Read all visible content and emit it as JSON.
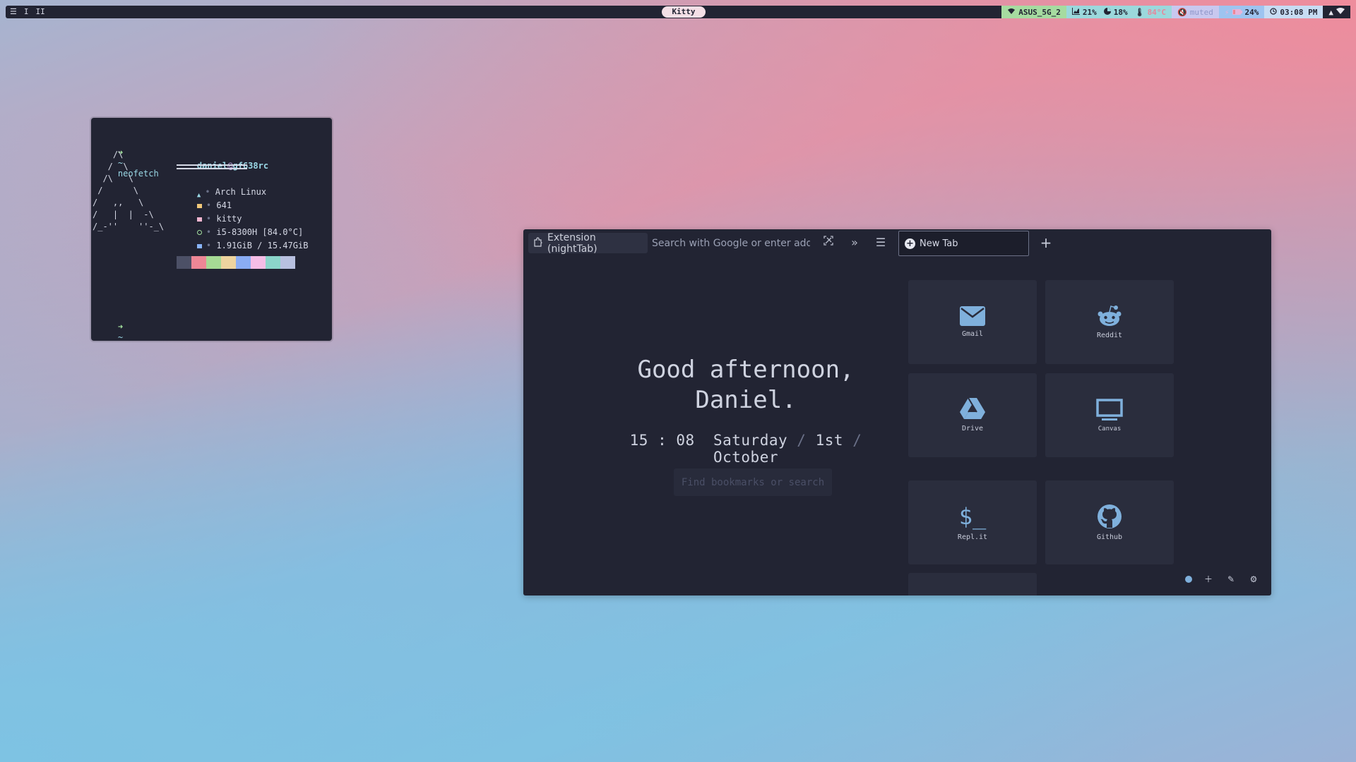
{
  "topbar": {
    "menu_icon": "hamburger-icon",
    "workspaces": [
      "I",
      "II"
    ],
    "window_title": "Kitty",
    "wifi": "ASUS_5G_2",
    "cpu": "21%",
    "memory": "18%",
    "temperature": "84°C",
    "volume": "muted",
    "battery": "24%",
    "time": "03:08 PM"
  },
  "terminal": {
    "prompt_symbol": "➜",
    "prompt_dir": "~",
    "command": "neofetch",
    "ascii_art": [
      "    /\\",
      "   /  \\",
      "  /\\   \\",
      " /      \\",
      "/   ,,   \\",
      "/   |  |  -\\",
      "/_-''    ''-_\\"
    ],
    "user": "daniel",
    "at": "@",
    "host": "gf638rc",
    "info": [
      {
        "text": "Arch Linux",
        "color": "#9ad8e6"
      },
      {
        "text": "641",
        "color": "#f0c87a"
      },
      {
        "text": "kitty",
        "color": "#f2b6d0"
      },
      {
        "text": "i5-8300H [84.0°C]",
        "color": "#a6e3a1"
      },
      {
        "text": "1.91GiB / 15.47GiB",
        "color": "#89b4fa"
      }
    ],
    "separator": "•",
    "palette": [
      "#4c5066",
      "#ed8796",
      "#a6da95",
      "#eed49f",
      "#8aadf4",
      "#f5bde6",
      "#8bd5ca",
      "#b8c0e0"
    ]
  },
  "browser": {
    "extension_chip": "Extension (nightTab)",
    "url_placeholder": "Search with Google or enter address",
    "tab_title": "New Tab",
    "greeting_line1": "Good afternoon,",
    "greeting_line2": "Daniel.",
    "clock": {
      "hours": "15",
      "colon": ":",
      "minutes": "08",
      "day": "Saturday",
      "slash": "/",
      "date": "1st",
      "month": "October"
    },
    "bookmark_search_placeholder": "Find bookmarks or search",
    "tiles": [
      {
        "name": "Gmail",
        "icon": "envelope-icon"
      },
      {
        "name": "Reddit",
        "icon": "reddit-icon"
      },
      {
        "name": "Drive",
        "icon": "drive-icon"
      },
      {
        "name": "Canvas",
        "icon": "monitor-icon"
      },
      {
        "name": "Repl.it",
        "icon": "terminal-icon"
      },
      {
        "name": "Github",
        "icon": "github-icon"
      }
    ],
    "accent": "#7fb0dc"
  }
}
